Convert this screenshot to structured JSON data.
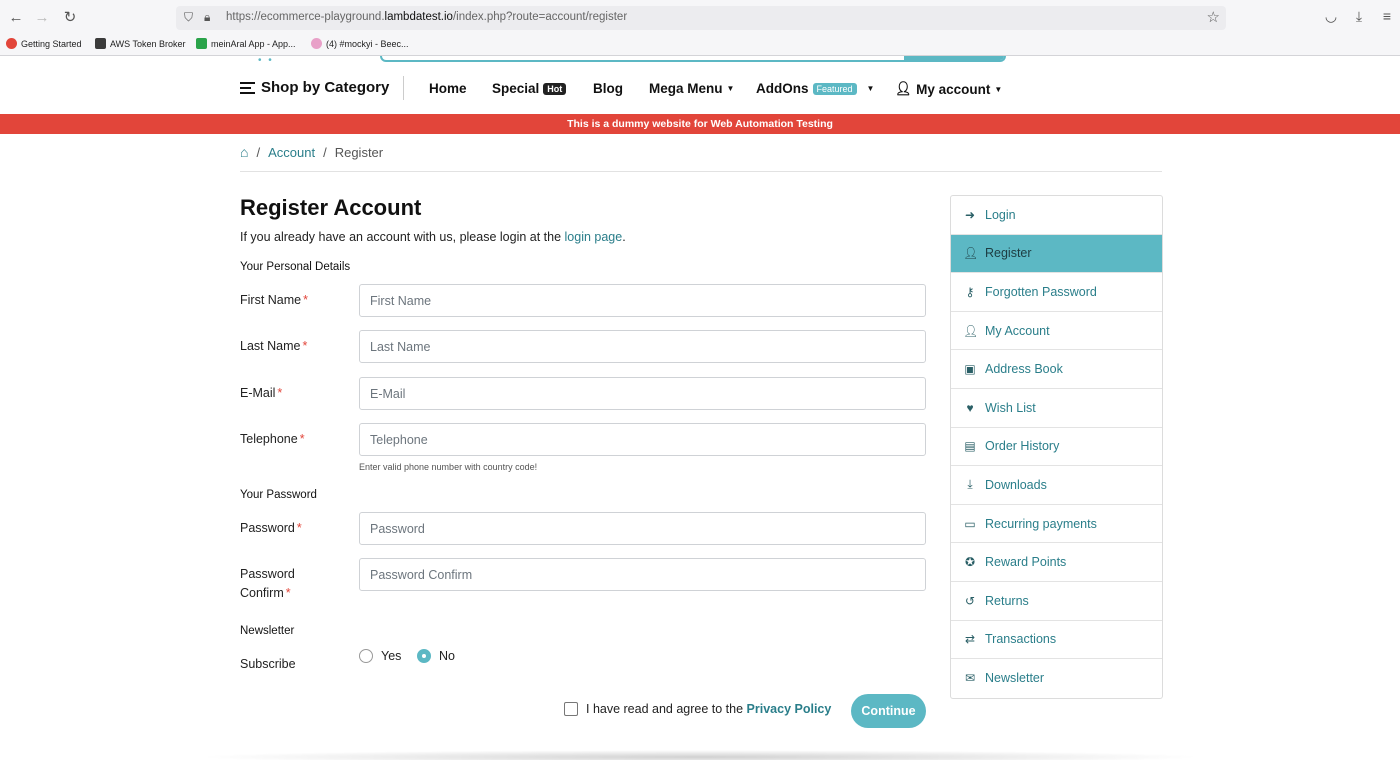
{
  "browser": {
    "url_prefix": "https://ecommerce-playground.",
    "url_domain": "lambdatest.io",
    "url_path": "/index.php?route=account/register",
    "bookmarks": [
      {
        "label": "Getting Started",
        "color": "#e2453a"
      },
      {
        "label": "AWS Token Broker",
        "color": "#3b3b3b"
      },
      {
        "label": "meinAral App - App...",
        "color": "#2aa34a"
      },
      {
        "label": "(4) #mockyi - Beec...",
        "color": "#e8a0c8"
      }
    ]
  },
  "nav": {
    "category": "Shop by Category",
    "home": "Home",
    "special": "Special",
    "hot_badge": "Hot",
    "blog": "Blog",
    "mega_menu": "Mega Menu",
    "addons": "AddOns",
    "featured_badge": "Featured",
    "my_account": "My account"
  },
  "banner": "This is a dummy website for Web Automation Testing",
  "breadcrumb": {
    "account": "Account",
    "current": "Register"
  },
  "form": {
    "title": "Register Account",
    "intro_prefix": "If you already have an account with us, please login at the ",
    "intro_link": "login page",
    "intro_suffix": ".",
    "personal_heading": "Your Personal Details",
    "first_name_label": "First Name",
    "first_name_placeholder": "First Name",
    "last_name_label": "Last Name",
    "last_name_placeholder": "Last Name",
    "email_label": "E-Mail",
    "email_placeholder": "E-Mail",
    "telephone_label": "Telephone",
    "telephone_placeholder": "Telephone",
    "telephone_help": "Enter valid phone number with country code!",
    "password_heading": "Your Password",
    "password_label": "Password",
    "password_placeholder": "Password",
    "password_confirm_label_1": "Password",
    "password_confirm_label_2": "Confirm",
    "password_confirm_placeholder": "Password Confirm",
    "newsletter_heading": "Newsletter",
    "subscribe_label": "Subscribe",
    "yes": "Yes",
    "no": "No",
    "subscribe_selected": "No",
    "agree_text": "I have read and agree to the ",
    "privacy_link": "Privacy Policy",
    "continue": "Continue",
    "required_mark": "*"
  },
  "sidebar": {
    "items": [
      {
        "label": "Login",
        "icon": "sign-in-icon"
      },
      {
        "label": "Register",
        "icon": "user-plus-icon"
      },
      {
        "label": "Forgotten Password",
        "icon": "key-icon"
      },
      {
        "label": "My Account",
        "icon": "user-icon"
      },
      {
        "label": "Address Book",
        "icon": "address-book-icon"
      },
      {
        "label": "Wish List",
        "icon": "heart-icon"
      },
      {
        "label": "Order History",
        "icon": "box-icon"
      },
      {
        "label": "Downloads",
        "icon": "download-icon"
      },
      {
        "label": "Recurring payments",
        "icon": "credit-card-icon"
      },
      {
        "label": "Reward Points",
        "icon": "medal-icon"
      },
      {
        "label": "Returns",
        "icon": "undo-icon"
      },
      {
        "label": "Transactions",
        "icon": "exchange-icon"
      },
      {
        "label": "Newsletter",
        "icon": "envelope-icon"
      }
    ],
    "active": "Register"
  },
  "colors": {
    "accent": "#5cb8c4",
    "banner": "#e2453a",
    "link": "#2a7e8a"
  }
}
